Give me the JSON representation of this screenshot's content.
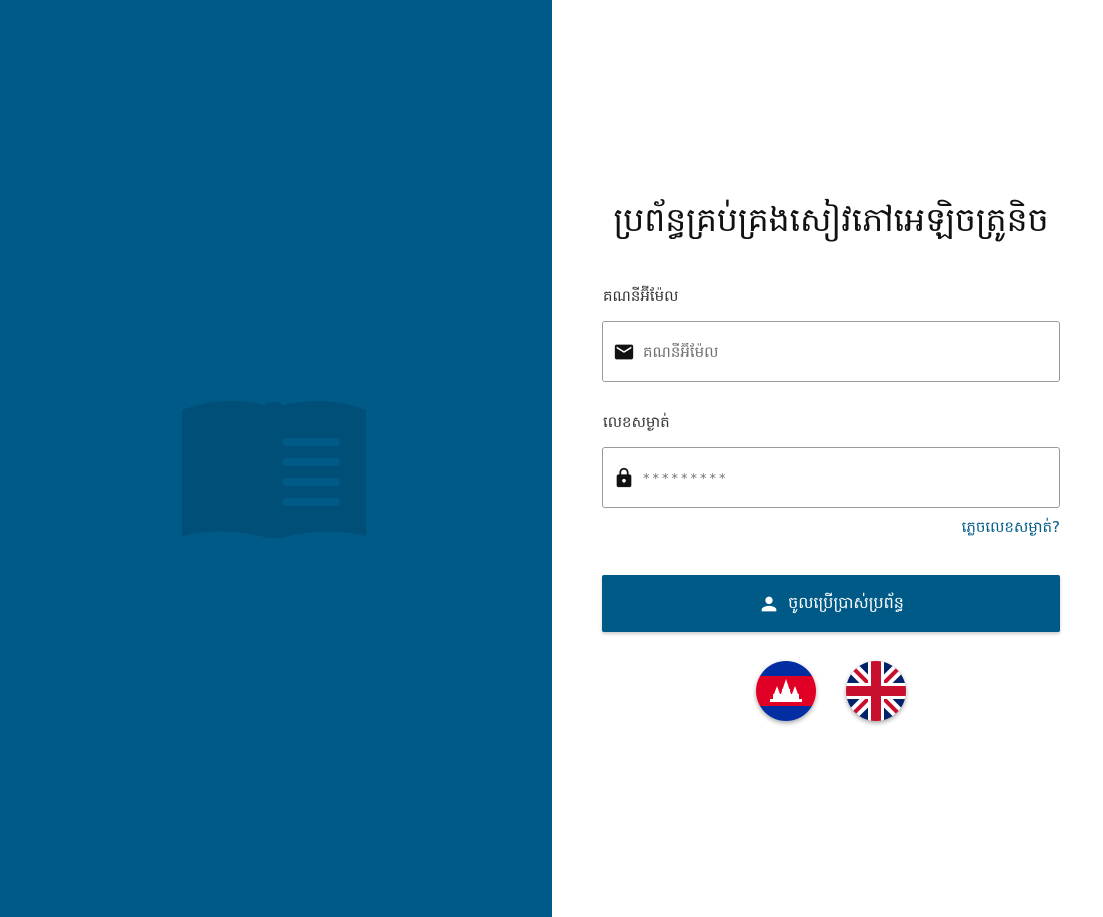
{
  "app": {
    "title": "ប្រព័ន្ធគ្រប់គ្រងសៀវភៅអេឡិចត្រូនិច"
  },
  "email": {
    "label": "គណនីអ៊ីម៉ែល",
    "placeholder": "គណនីអ៊ីម៉ែល",
    "value": "",
    "icon": "mail-icon"
  },
  "password": {
    "label": "លេខសម្ងាត់",
    "placeholder": "*********",
    "value": "",
    "icon": "lock-icon"
  },
  "forgot_password": "ភ្លេចលេខសម្ងាត់?",
  "login_button": {
    "label": "ចូលប្រើប្រាស់ប្រព័ន្ធ",
    "icon": "person-icon"
  },
  "languages": [
    {
      "name": "khmer",
      "icon": "cambodia-flag-icon"
    },
    {
      "name": "english",
      "icon": "uk-flag-icon"
    }
  ],
  "colors": {
    "primary": "#005a87",
    "logo": "#004f78"
  }
}
